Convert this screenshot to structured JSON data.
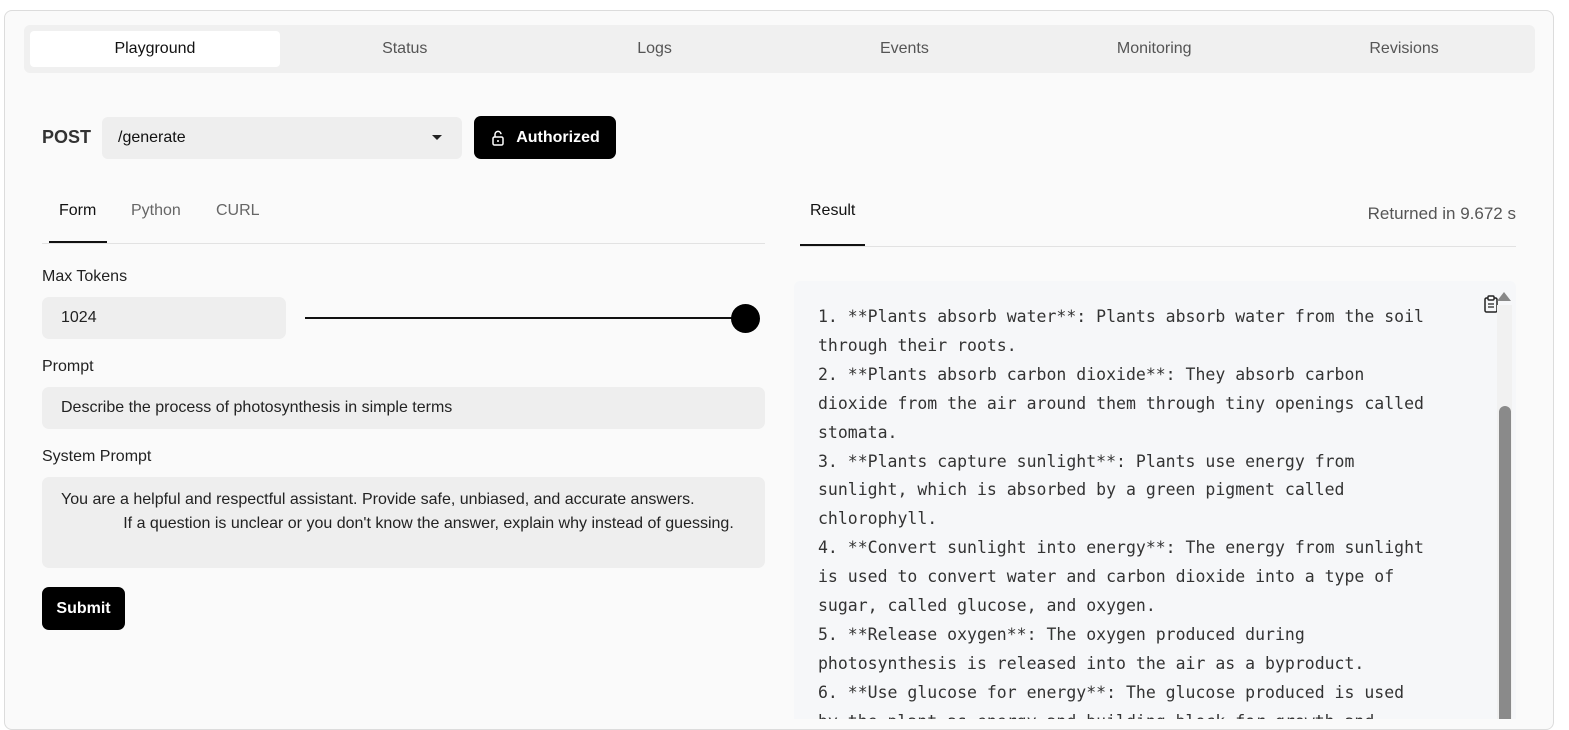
{
  "top_tabs": [
    "Playground",
    "Status",
    "Logs",
    "Events",
    "Monitoring",
    "Revisions"
  ],
  "active_top_tab": "Playground",
  "endpoint": {
    "method": "POST",
    "path": "/generate",
    "auth_label": "Authorized"
  },
  "form_tabs": [
    "Form",
    "Python",
    "CURL"
  ],
  "active_form_tab": "Form",
  "result": {
    "tab_label": "Result",
    "returned_text": "Returned in 9.672 s",
    "lines": [
      "1. **Plants absorb water**: Plants absorb water from the soil",
      "through their roots.",
      "2. **Plants absorb carbon dioxide**: They absorb carbon",
      "dioxide from the air around them through tiny openings called",
      "stomata.",
      "3. **Plants capture sunlight**: Plants use energy from",
      "sunlight, which is absorbed by a green pigment called",
      "chlorophyll.",
      "4. **Convert sunlight into energy**: The energy from sunlight",
      "is used to convert water and carbon dioxide into a type of",
      "sugar, called glucose, and oxygen.",
      "5. **Release oxygen**: The oxygen produced during",
      "photosynthesis is released into the air as a byproduct.",
      "6. **Use glucose for energy**: The glucose produced is used",
      "by the plant as energy and building block for growth and"
    ]
  },
  "fields": {
    "max_tokens": {
      "label": "Max Tokens",
      "value": "1024",
      "slider_fraction": 1.0
    },
    "prompt": {
      "label": "Prompt",
      "value": "Describe the process of photosynthesis in simple terms"
    },
    "system_prompt": {
      "label": "System Prompt",
      "value": "You are a helpful and respectful assistant. Provide safe, unbiased, and accurate answers.\n              If a question is unclear or you don't know the answer, explain why instead of guessing."
    }
  },
  "submit_label": "Submit",
  "icons": {
    "lock": "unlock-icon",
    "dropdown": "chevron-down-icon",
    "copy": "clipboard-icon"
  }
}
